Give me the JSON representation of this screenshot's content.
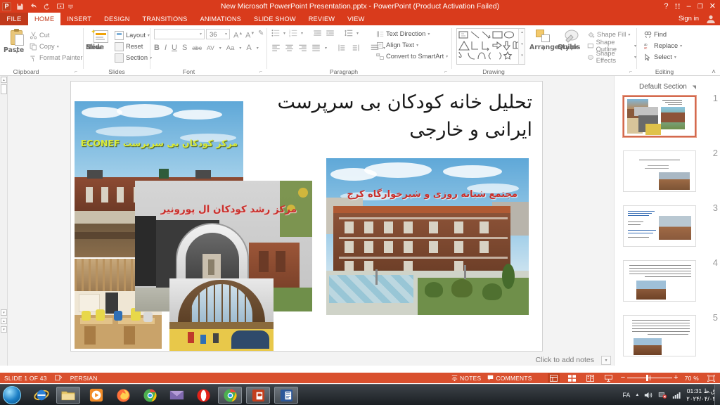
{
  "titlebar": {
    "document_title": "New Microsoft PowerPoint Presentation.pptx  -  PowerPoint (Product Activation Failed)",
    "app_icon": "powerpoint-icon",
    "quick_access": [
      {
        "name": "save-icon",
        "label": "Save"
      },
      {
        "name": "undo-icon",
        "label": "Undo"
      },
      {
        "name": "redo-icon",
        "label": "Redo"
      },
      {
        "name": "start-presentation-icon",
        "label": "Start From Beginning"
      },
      {
        "name": "customize-qat-icon",
        "label": "Customize Quick Access Toolbar"
      }
    ],
    "window_controls": {
      "help": "?",
      "ribbon_options": "☷",
      "minimize": "–",
      "restore": "❐",
      "close": "✕"
    }
  },
  "tabs": {
    "file": "FILE",
    "items": [
      "HOME",
      "INSERT",
      "DESIGN",
      "TRANSITIONS",
      "ANIMATIONS",
      "SLIDE SHOW",
      "REVIEW",
      "VIEW"
    ],
    "active": "HOME",
    "sign_in": "Sign in"
  },
  "ribbon": {
    "clipboard": {
      "group_label": "Clipboard",
      "paste": "Paste",
      "cut": "Cut",
      "copy": "Copy",
      "format_painter": "Format Painter"
    },
    "slides": {
      "group_label": "Slides",
      "new_slide_line1": "New",
      "new_slide_line2": "Slide",
      "layout": "Layout",
      "reset": "Reset",
      "section": "Section"
    },
    "font": {
      "group_label": "Font",
      "font_name": "",
      "font_name_placeholder": "",
      "font_size": "36",
      "increase_size": "A",
      "decrease_size": "A",
      "clear_formatting": "Clear All Formatting",
      "bold": "B",
      "italic": "I",
      "underline": "U",
      "shadow": "S",
      "strikethrough": "abc",
      "character_spacing": "AV",
      "change_case": "Aa",
      "font_color": "A"
    },
    "paragraph": {
      "group_label": "Paragraph",
      "text_direction": "Text Direction",
      "align_text": "Align Text",
      "convert_to_smartart": "Convert to SmartArt"
    },
    "drawing": {
      "group_label": "Drawing",
      "arrange": "Arrange",
      "quick_styles_line1": "Quick",
      "quick_styles_line2": "Styles",
      "shape_fill": "Shape Fill",
      "shape_outline": "Shape Outline",
      "shape_effects": "Shape Effects"
    },
    "editing": {
      "group_label": "Editing",
      "find": "Find",
      "replace": "Replace",
      "select": "Select"
    },
    "collapse_ribbon": "˄"
  },
  "slide": {
    "title_line1": "تحلیل خانه کودکان بی سرپرست",
    "title_line2": "ایرانی و خارجی",
    "images": [
      {
        "name": "econef-orphanage-photo",
        "caption": "مرکز کودکان بی سرپرست ECONEF",
        "caption_color": "#d9ea3a"
      },
      {
        "name": "el-pourvenir-center-photo",
        "caption": "مرکز رشد کودکان ال پورونیر",
        "caption_color": "#c9302c"
      },
      {
        "name": "karaj-nursery-complex-photo",
        "caption": "مجتمع شبانه روزی و شیرخوارگاه کرج",
        "caption_color": "#c9302c"
      },
      {
        "name": "classroom-children-photo",
        "caption": "",
        "caption_color": ""
      },
      {
        "name": "vaulted-hall-interior-photo",
        "caption": "",
        "caption_color": ""
      }
    ]
  },
  "notes": {
    "placeholder": "Click to add notes"
  },
  "thumbnails": {
    "section_title": "Default Section",
    "slides": [
      {
        "number": "1",
        "selected": true
      },
      {
        "number": "2",
        "selected": false
      },
      {
        "number": "3",
        "selected": false
      },
      {
        "number": "4",
        "selected": false
      },
      {
        "number": "5",
        "selected": false
      }
    ]
  },
  "status_bar": {
    "slide_counter": "SLIDE 1 OF 43",
    "language": "PERSIAN",
    "spellcheck_icon": "proofing-icon",
    "notes_button": "NOTES",
    "comments_button": "COMMENTS",
    "views": [
      {
        "name": "normal-view-button",
        "active": true
      },
      {
        "name": "slide-sorter-view-button",
        "active": false
      },
      {
        "name": "reading-view-button",
        "active": false
      },
      {
        "name": "slideshow-view-button",
        "active": false
      }
    ],
    "zoom_out": "−",
    "zoom_in": "+",
    "zoom_level": "70 %",
    "fit_to_window": "fit-slide-icon"
  },
  "taskbar": {
    "start": "start-orb",
    "items": [
      {
        "name": "internet-explorer-icon",
        "framed": false
      },
      {
        "name": "windows-explorer-icon",
        "framed": true
      },
      {
        "name": "media-player-icon",
        "framed": false
      },
      {
        "name": "firefox-icon",
        "framed": false
      },
      {
        "name": "chrome-icon",
        "framed": false
      },
      {
        "name": "thunderbird-icon",
        "framed": false
      },
      {
        "name": "opera-icon",
        "framed": false
      },
      {
        "name": "chrome-window-icon",
        "framed": true
      },
      {
        "name": "powerpoint-window-icon",
        "framed": true
      },
      {
        "name": "word-window-icon",
        "framed": true
      }
    ],
    "tray": {
      "language": "FA",
      "show_hidden_icons": "▲",
      "volume_icon": "speaker-icon",
      "network_icon": "network-error-icon",
      "signal_icon": "signal-bars-icon",
      "time": "01:31 ق.ظ",
      "date": "۲۰۲۴/۰۴/۰۴"
    }
  },
  "colors": {
    "accent": "#d93b1c",
    "status_bar": "#d9502e",
    "tab_active_text": "#c0391b"
  }
}
